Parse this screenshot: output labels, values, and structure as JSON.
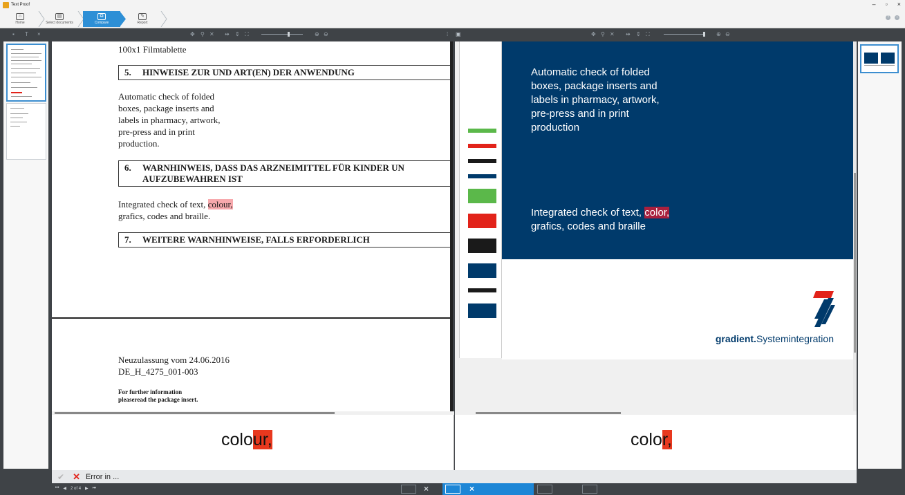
{
  "window": {
    "title": "Text Proof"
  },
  "ribbon": {
    "steps": [
      {
        "label": "Home"
      },
      {
        "label": "Select documents"
      },
      {
        "label": "Compare"
      },
      {
        "label": "Report"
      }
    ]
  },
  "left_doc": {
    "top_line": "100x1 Filmtablette",
    "sections": [
      {
        "num": "5.",
        "title": "HINWEISE ZUR UND ART(EN) DER ANWENDUNG"
      },
      {
        "num": "6.",
        "title": "WARNHINWEIS, DASS DAS ARZNEIMITTEL FÜR KINDER UN",
        "title2": "AUFZUBEWAHREN IST"
      },
      {
        "num": "7.",
        "title": "WEITERE WARNHINWEISE, FALLS ERFORDERLICH"
      }
    ],
    "para1": [
      "Automatic check of folded",
      "boxes, package inserts and",
      "labels in pharmacy, artwork,",
      "pre-press and in print",
      "production."
    ],
    "para2_pre": "Integrated check of text, ",
    "para2_hl": "colour,",
    "para2_line2": "grafics, codes and braille.",
    "footer1": "Neuzulassung vom 24.06.2016",
    "footer2": "DE_H_4275_001-003",
    "footer3": "For further information",
    "footer4": "pleaseread the package insert."
  },
  "right_doc": {
    "para1": [
      "Automatic check of folded",
      "boxes, package inserts and",
      "labels in pharmacy, artwork,",
      "pre-press and in print",
      "production"
    ],
    "para2_pre": "Integrated check of text, ",
    "para2_hl": "color,",
    "para2_line2": "grafics, codes and braille",
    "brand_bold": "gradient.",
    "brand_rest": "Systemintegration",
    "color_bars": [
      {
        "color": "#5bb84a"
      },
      {
        "color": "#e2231a"
      },
      {
        "color": "#1a1a1a"
      },
      {
        "color": "#003a6b"
      },
      {
        "color": "#5bb84a"
      },
      {
        "color": "#e2231a"
      },
      {
        "color": "#1a1a1a"
      },
      {
        "color": "#003a6b"
      },
      {
        "color": "#1a1a1a"
      },
      {
        "color": "#003a6b"
      }
    ]
  },
  "diff": {
    "left_plain": "colo",
    "left_mark": "ur,",
    "right_plain": "colo",
    "right_mark": "r,"
  },
  "errors": {
    "label": "Error in ..."
  },
  "status": {
    "page": "2 of 4"
  },
  "colors": {
    "accent": "#2d8fd6",
    "navy": "#003a6b",
    "error": "#e2231a"
  }
}
